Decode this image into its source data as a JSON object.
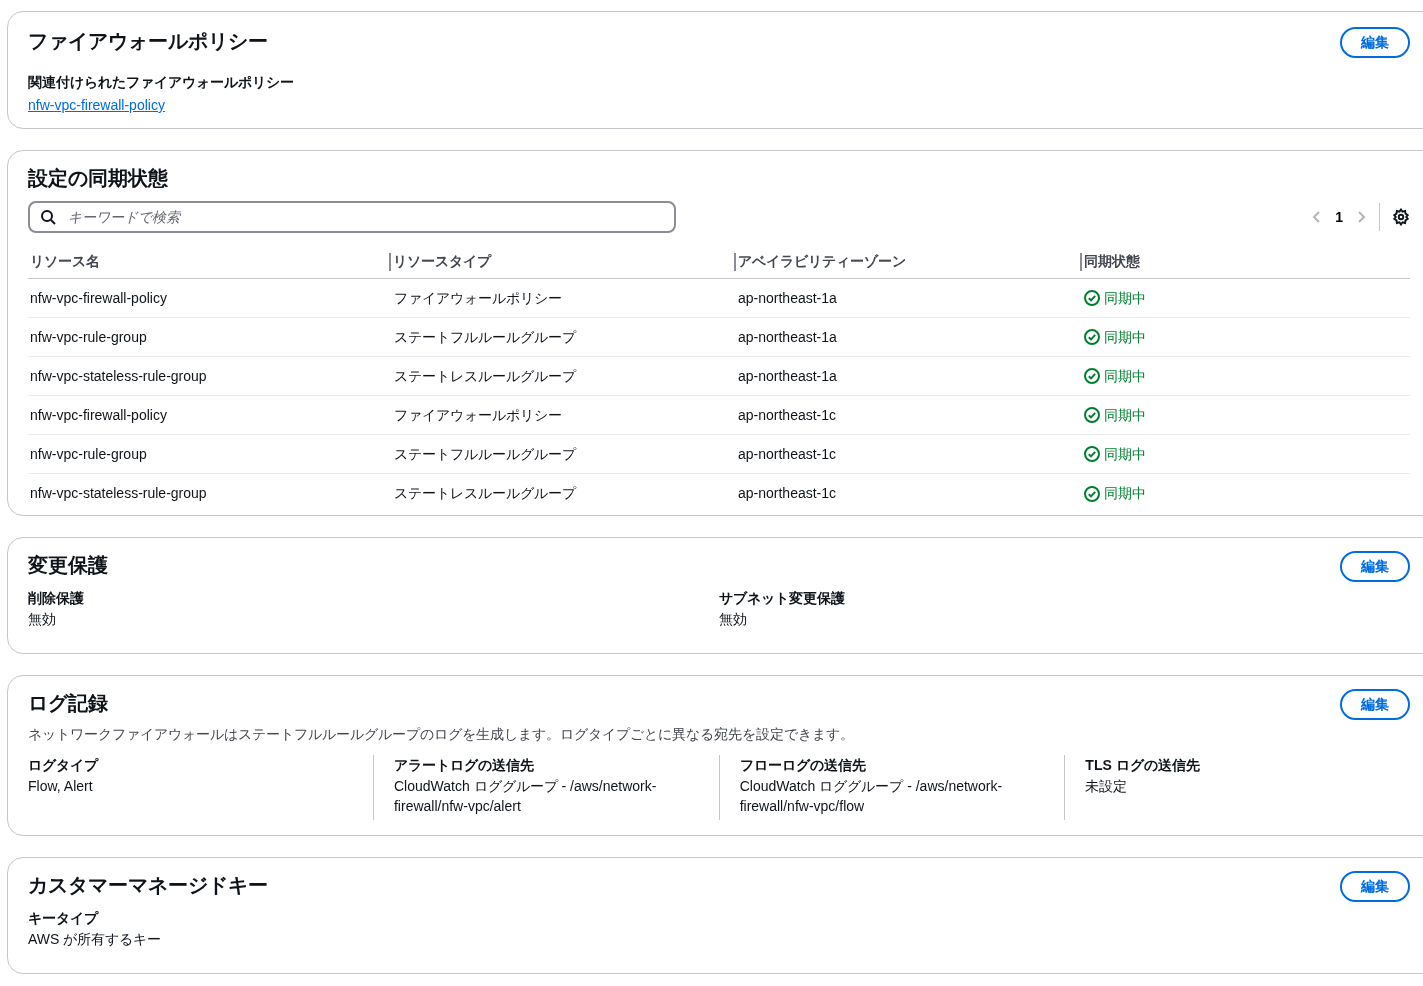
{
  "firewall_policy": {
    "title": "ファイアウォールポリシー",
    "edit_button": "編集",
    "label": "関連付けられたファイアウォールポリシー",
    "link": "nfw-vpc-firewall-policy"
  },
  "sync_status": {
    "title": "設定の同期状態",
    "search": {
      "placeholder": "キーワードで検索"
    },
    "pagination": {
      "page": "1"
    },
    "table": {
      "columns": [
        "リソース名",
        "リソースタイプ",
        "アベイラビリティーゾーン",
        "同期状態"
      ],
      "rows": [
        {
          "name": "nfw-vpc-firewall-policy",
          "type": "ファイアウォールポリシー",
          "zone": "ap-northeast-1a",
          "status": "同期中",
          "kind": "synced"
        },
        {
          "name": "nfw-vpc-rule-group",
          "type": "ステートフルルールグループ",
          "zone": "ap-northeast-1a",
          "status": "同期中",
          "kind": "synced"
        },
        {
          "name": "nfw-vpc-stateless-rule-group",
          "type": "ステートレスルールグループ",
          "zone": "ap-northeast-1a",
          "status": "同期中",
          "kind": "synced"
        },
        {
          "name": "nfw-vpc-firewall-policy",
          "type": "ファイアウォールポリシー",
          "zone": "ap-northeast-1c",
          "status": "同期中",
          "kind": "synced"
        },
        {
          "name": "nfw-vpc-rule-group",
          "type": "ステートフルルールグループ",
          "zone": "ap-northeast-1c",
          "status": "同期中",
          "kind": "synced"
        },
        {
          "name": "nfw-vpc-stateless-rule-group",
          "type": "ステートレスルールグループ",
          "zone": "ap-northeast-1c",
          "status": "同期中",
          "kind": "synced"
        }
      ]
    }
  },
  "change_protection": {
    "title": "変更保護",
    "edit_button": "編集",
    "fields": [
      {
        "label": "削除保護",
        "value": "無効"
      },
      {
        "label": "サブネット変更保護",
        "value": "無効"
      }
    ]
  },
  "logging": {
    "title": "ログ記録",
    "edit_button": "編集",
    "description": "ネットワークファイアウォールはステートフルルールグループのログを生成します。ログタイプごとに異なる宛先を設定できます。",
    "fields": [
      {
        "label": "ログタイプ",
        "value": "Flow, Alert"
      },
      {
        "label": "アラートログの送信先",
        "value": "CloudWatch ロググループ - /aws/network-firewall/nfw-vpc/alert"
      },
      {
        "label": "フローログの送信先",
        "value": "CloudWatch ロググループ - /aws/network-firewall/nfw-vpc/flow"
      },
      {
        "label": "TLS ログの送信先",
        "value": "未設定"
      }
    ]
  },
  "customer_managed_key": {
    "title": "カスタマーマネージドキー",
    "edit_button": "編集",
    "fields": [
      {
        "label": "キータイプ",
        "value": "AWS が所有するキー"
      }
    ]
  }
}
